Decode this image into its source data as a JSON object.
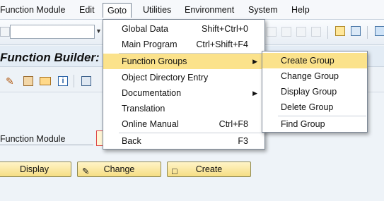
{
  "menubar": {
    "items": [
      {
        "label": "Function Module",
        "ul": "F"
      },
      {
        "label": "Edit",
        "ul": "E"
      },
      {
        "label": "Goto",
        "ul": "G"
      },
      {
        "label": "Utilities",
        "ul": "U"
      },
      {
        "label": "Environment",
        "ul": "n"
      },
      {
        "label": "System",
        "ul": "S"
      },
      {
        "label": "Help",
        "ul": "H"
      }
    ]
  },
  "toolbar": {
    "command_field_value": ""
  },
  "title": "Function Builder: ...",
  "field": {
    "label": "Function Module",
    "value": ""
  },
  "buttons": {
    "display": "Display",
    "change": "Change",
    "create": "Create"
  },
  "goto_menu": {
    "items": [
      {
        "label": "Global Data",
        "shortcut": "Shift+Ctrl+0"
      },
      {
        "label": "Main Program",
        "shortcut": "Ctrl+Shift+F4"
      },
      {
        "label": "Function Groups",
        "shortcut": ""
      },
      {
        "label": "Object Directory Entry",
        "shortcut": ""
      },
      {
        "label": "Documentation",
        "shortcut": ""
      },
      {
        "label": "Translation",
        "shortcut": ""
      },
      {
        "label": "Online Manual",
        "shortcut": "Ctrl+F8"
      },
      {
        "label": "Back",
        "shortcut": "F3"
      }
    ]
  },
  "function_groups_submenu": {
    "items": [
      {
        "label": "Create Group"
      },
      {
        "label": "Change Group"
      },
      {
        "label": "Display Group"
      },
      {
        "label": "Delete Group"
      },
      {
        "label": "Find Group"
      }
    ]
  },
  "colors": {
    "highlight": "#fbe28b",
    "button_bg": "#f6de84"
  }
}
